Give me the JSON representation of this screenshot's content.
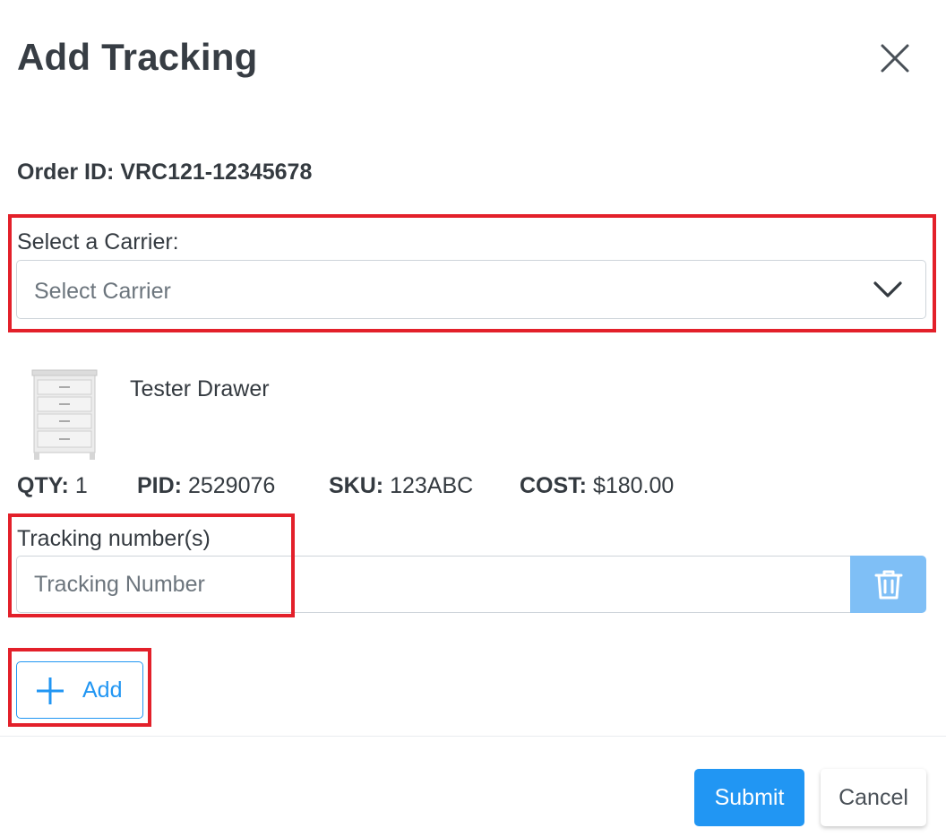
{
  "modal": {
    "title": "Add Tracking",
    "close_icon": "close-icon"
  },
  "order": {
    "label": "Order ID:",
    "value": "VRC121-12345678"
  },
  "carrier": {
    "label": "Select a Carrier:",
    "placeholder": "Select Carrier",
    "icon": "chevron-down-icon"
  },
  "product": {
    "name": "Tester Drawer",
    "image_icon": "dresser-image",
    "qty_label": "QTY:",
    "qty_value": "1",
    "pid_label": "PID:",
    "pid_value": "2529076",
    "sku_label": "SKU:",
    "sku_value": "123ABC",
    "cost_label": "COST:",
    "cost_value": "$180.00"
  },
  "tracking": {
    "label": "Tracking number(s)",
    "placeholder": "Tracking Number",
    "delete_icon": "trash-icon"
  },
  "add_button": {
    "label": "Add",
    "icon": "plus-icon"
  },
  "footer": {
    "submit_label": "Submit",
    "cancel_label": "Cancel"
  },
  "colors": {
    "highlight": "#e3202a",
    "primary": "#2196f3",
    "delete_button": "#7fbff6"
  }
}
